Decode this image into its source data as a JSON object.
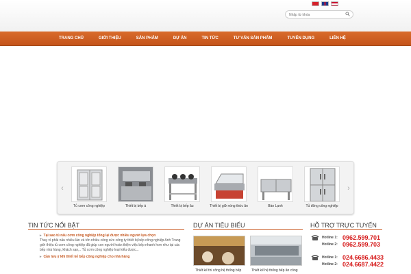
{
  "header": {
    "search_placeholder": "Nhập từ khóa",
    "languages": [
      "vi-flag-icon",
      "en-flag-icon",
      "my-flag-icon"
    ]
  },
  "nav": {
    "items": [
      "TRANG CHỦ",
      "GIỚI THIỆU",
      "SẢN PHẨM",
      "DỰ ÁN",
      "TIN TỨC",
      "TƯ VẤN SẢN PHẨM",
      "TUYỂN DỤNG",
      "LIÊN HỆ"
    ]
  },
  "carousel": {
    "products": [
      "Tủ cơm công nghiệp",
      "Thiết bị bếp á",
      "Thiết bị bếp âu",
      "Thiết bị giữ nóng thức ăn",
      "Bàn Lạnh",
      "Tủ đông công nghiệp"
    ]
  },
  "news": {
    "heading": "TIN TỨC NỔI BẬT",
    "items": [
      {
        "title": "Tại sao tủ nấu cơm công nghiệp tổng lại được nhiều người lựa chọn",
        "excerpt": "Thay vì phải nấu nhiều lần và tốn nhiều công sức công ty thiết bị bếp công nghiệp Anh Trang giới thiệu tủ cơm công nghiệp đã giúp con người hoàn thiện việc bếp nhanh hơn như tại các bếp nhà hàng, khách sạn,.. Tủ cơm công nghiệp loại kiểu được..."
      },
      {
        "title": "Cần lưu ý khi thiết kế bếp công nghiệp cho nhà hàng",
        "excerpt": ""
      }
    ]
  },
  "projects": {
    "heading": "DỰ ÁN TIÊU BIỂU",
    "items": [
      "Thiết kế thi công hệ thống bếp",
      "Thiết kế hệ thống bếp ăn công"
    ]
  },
  "support": {
    "heading": "HỖ TRỢ TRỰC TUYẾN",
    "hotlines": [
      {
        "label": "Hotline 1:",
        "number": "0962.599.701"
      },
      {
        "label": "Hotline 2:",
        "number": "0962.599.703"
      },
      {
        "label": "Hotline 1:",
        "number": "024.6686.4433"
      },
      {
        "label": "Hotline 2:",
        "number": "024.6687.4422"
      }
    ]
  }
}
